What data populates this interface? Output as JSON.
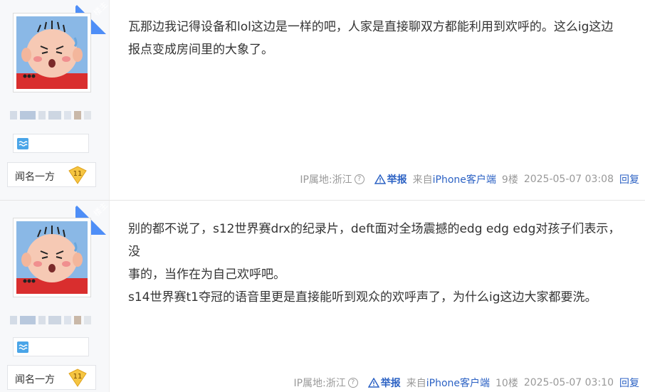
{
  "author_badge": "楼主",
  "posts": [
    {
      "content_lines": [
        "瓦那边我记得设备和lol这边是一样的吧，人家是直接聊双方都能利用到欢呼的。这么ig这边",
        "报点变成房间里的大象了。"
      ],
      "level_name": "闻名一方",
      "level_number": "11",
      "ip_label": "IP属地:浙江",
      "report_label": "举报",
      "client_prefix": "来自",
      "client_name": "iPhone客户端",
      "floor": "9楼",
      "datetime": "2025-05-07 03:08",
      "reply_label": "回复"
    },
    {
      "content_lines": [
        "别的都不说了，s12世界赛drx的纪录片，deft面对全场震撼的edg edg edg对孩子们表示，没",
        "事的，当作在为自己欢呼吧。",
        "s14世界赛t1夺冠的语音里更是直接能听到观众的欢呼声了，为什么ig这边大家都要洗。"
      ],
      "level_name": "闻名一方",
      "level_number": "11",
      "ip_label": "IP属地:浙江",
      "report_label": "举报",
      "client_prefix": "来自",
      "client_name": "iPhone客户端",
      "floor": "10楼",
      "datetime": "2025-05-07 03:10",
      "reply_label": "回复"
    }
  ],
  "icons": {
    "help": "?",
    "help_icon": "question-circle-icon",
    "warn_icon": "warning-triangle-icon",
    "fan_icon": "wave-icon"
  },
  "colors": {
    "link": "#2c62c4",
    "badge_blue": "#4e8ef7",
    "meta_gray": "#999999"
  }
}
